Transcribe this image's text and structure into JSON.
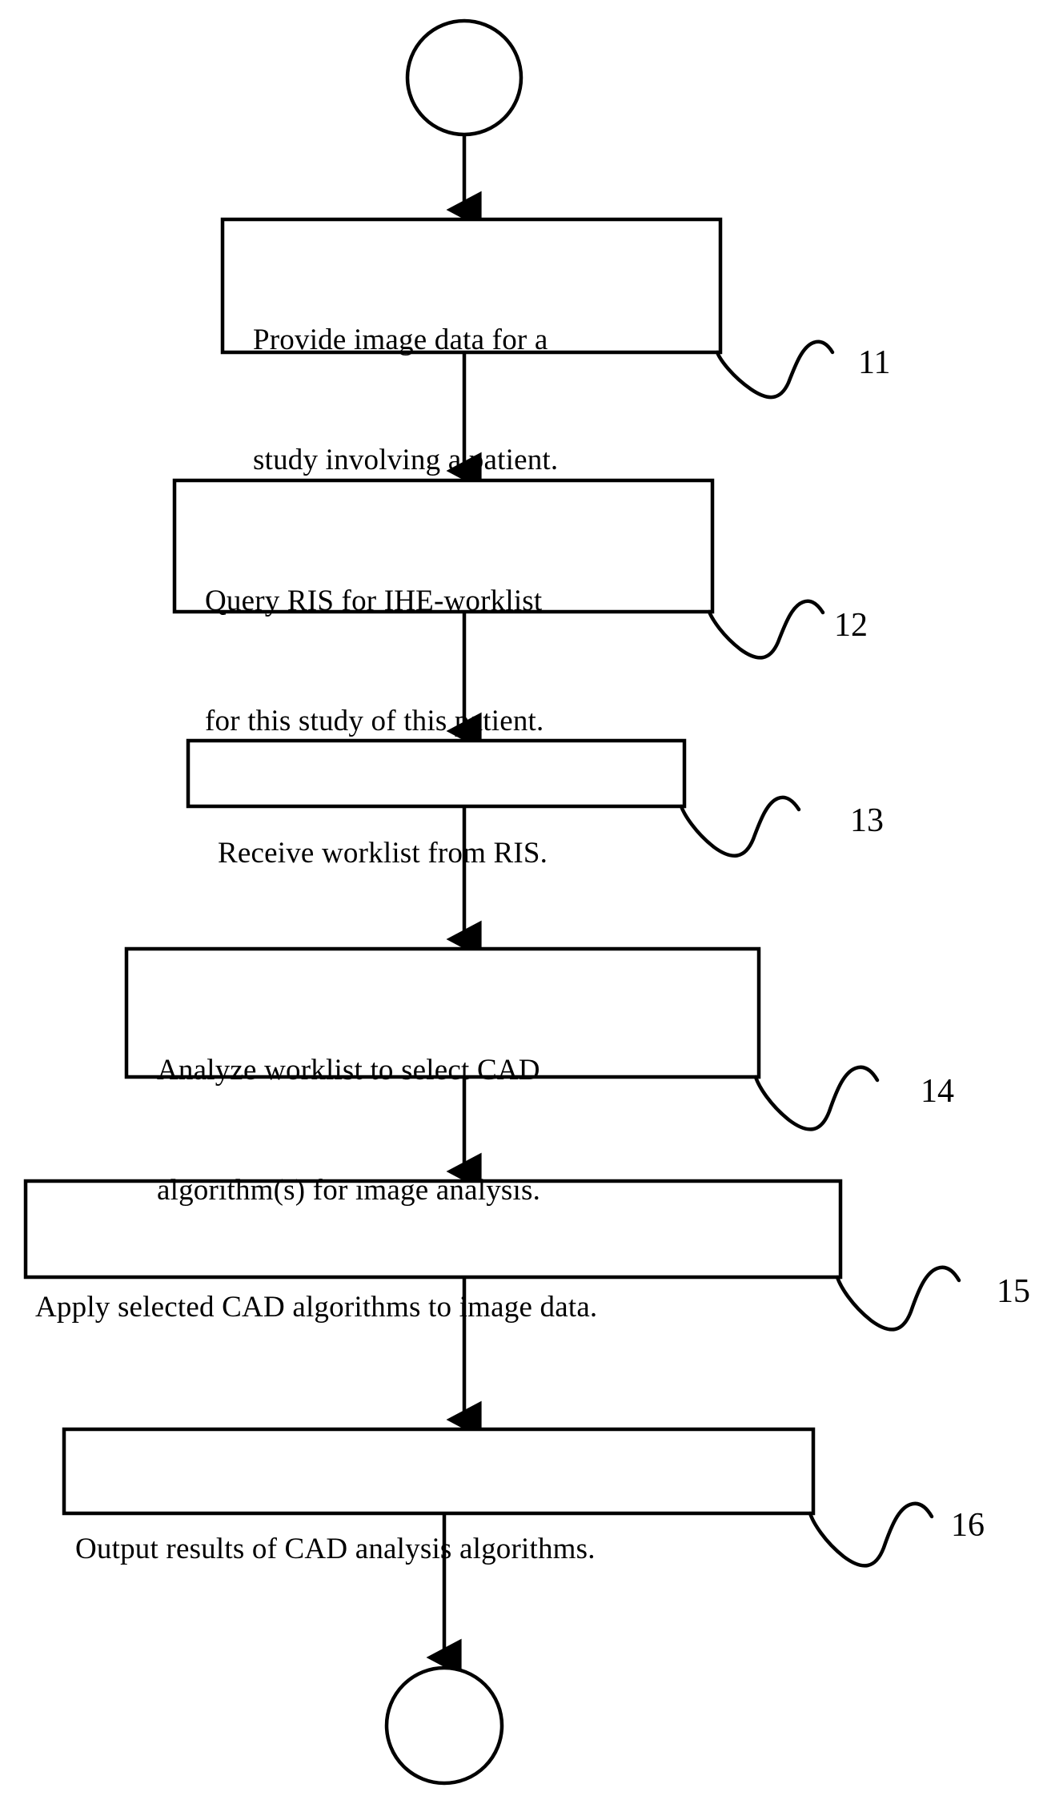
{
  "diagram": {
    "type": "flowchart",
    "title": "",
    "orientation": "vertical",
    "stroke_color": "#000000",
    "background_color": "#ffffff",
    "terminators": {
      "start": {
        "shape": "circle",
        "label": ""
      },
      "end": {
        "shape": "circle",
        "label": ""
      }
    },
    "steps": [
      {
        "ref": "11",
        "lines": [
          "Provide image data for a",
          "study involving a patient."
        ],
        "line1": "Provide image data for a",
        "line2": "study involving a patient."
      },
      {
        "ref": "12",
        "lines": [
          "Query RIS for IHE-worklist",
          "for this study of this patient."
        ],
        "line1": "Query RIS for IHE-worklist",
        "line2": "for this study of this patient."
      },
      {
        "ref": "13",
        "lines": [
          "Receive worklist from RIS."
        ],
        "line1": "Receive worklist from RIS.",
        "line2": ""
      },
      {
        "ref": "14",
        "lines": [
          "Analyze worklist to select CAD",
          "algorithm(s) for image analysis."
        ],
        "line1": "Analyze worklist to select CAD",
        "line2": "algorithm(s) for image analysis."
      },
      {
        "ref": "15",
        "lines": [
          "Apply selected CAD algorithms to image data."
        ],
        "line1": "Apply selected CAD algorithms to image data.",
        "line2": ""
      },
      {
        "ref": "16",
        "lines": [
          "Output results of CAD analysis algorithms."
        ],
        "line1": "Output results of CAD analysis algorithms.",
        "line2": ""
      }
    ]
  }
}
